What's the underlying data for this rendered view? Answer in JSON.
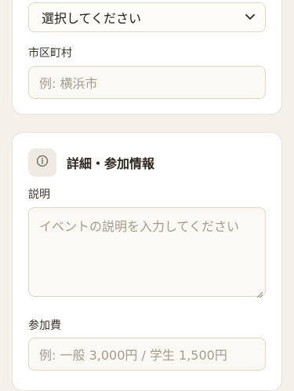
{
  "location": {
    "prefecture_select_value": "選択してください",
    "city_label": "市区町村",
    "city_placeholder": "例: 横浜市"
  },
  "details": {
    "title": "詳細・参加情報",
    "icon": "info-icon",
    "description_label": "説明",
    "description_placeholder": "イベントの説明を入力してください",
    "fee_label": "参加費",
    "fee_placeholder": "例: 一般 3,000円 / 学生 1,500円"
  },
  "colors": {
    "background": "#f4f1ea",
    "card": "#ffffff",
    "input_bg": "#fbf9f4",
    "border": "#ddd6c9",
    "placeholder": "#a39b8e"
  }
}
